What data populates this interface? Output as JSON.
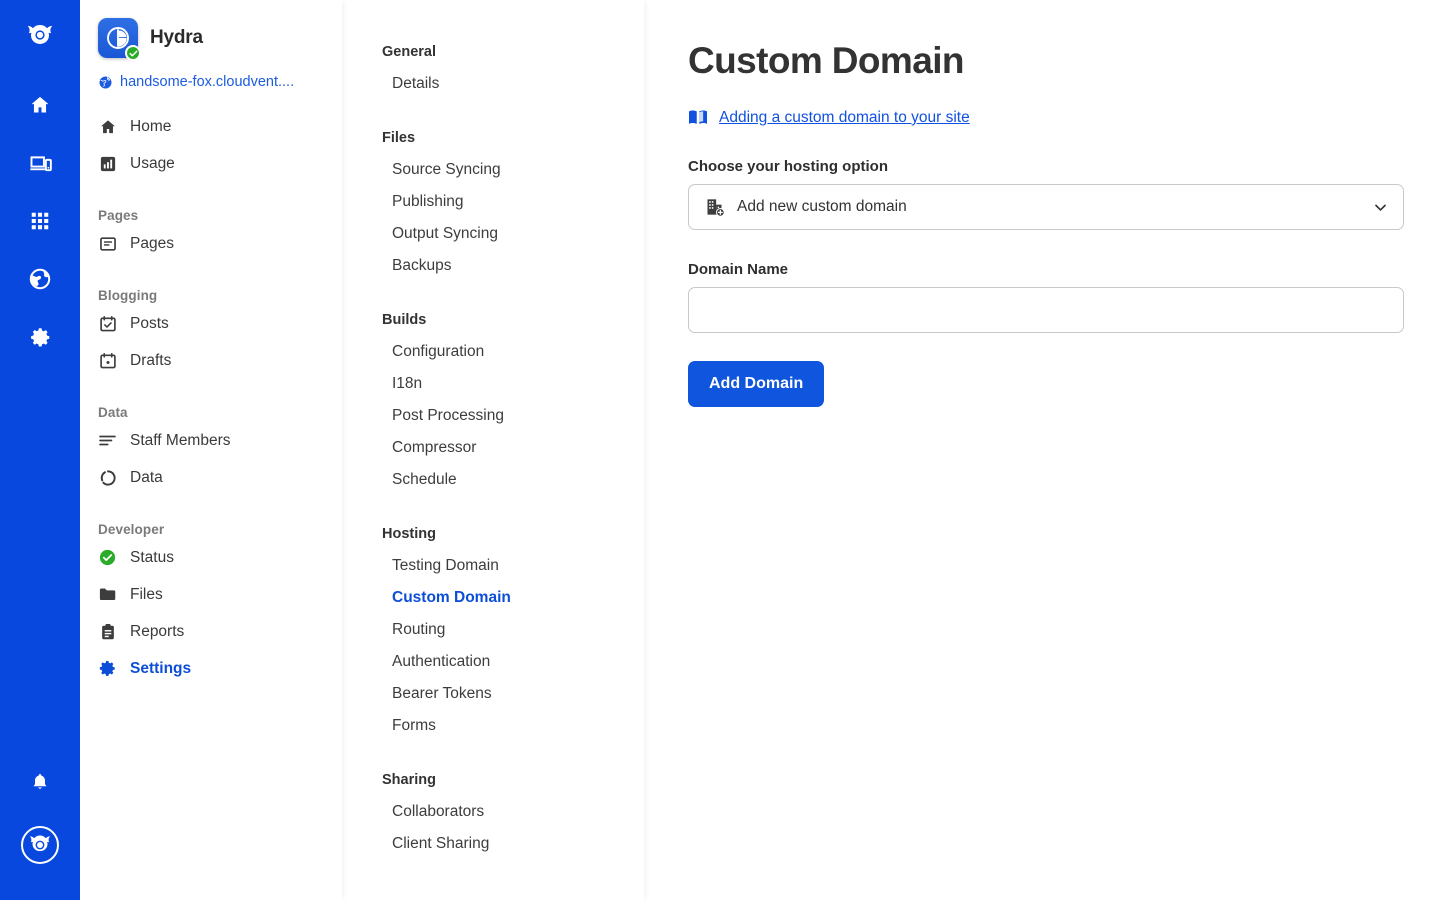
{
  "rail": {
    "logo_icon": "cloudvent-logo-icon",
    "items": [
      {
        "icon": "home-icon",
        "name": "home"
      },
      {
        "icon": "devices-icon",
        "name": "devices"
      },
      {
        "icon": "apps-grid-icon",
        "name": "apps"
      },
      {
        "icon": "globe-icon",
        "name": "globe"
      },
      {
        "icon": "gear-icon",
        "name": "settings"
      }
    ],
    "bottom": [
      {
        "icon": "bell-icon",
        "name": "notifications"
      },
      {
        "icon": "account-avatar-icon",
        "name": "account"
      }
    ]
  },
  "sidebar": {
    "site_name": "Hydra",
    "site_status_badge": "verified-check",
    "site_url": "handsome-fox.cloudvent....",
    "groups": [
      {
        "label": "",
        "items": [
          {
            "label": "Home",
            "icon": "home-icon",
            "active": false
          },
          {
            "label": "Usage",
            "icon": "usage-chart-icon",
            "active": false
          }
        ]
      },
      {
        "label": "Pages",
        "items": [
          {
            "label": "Pages",
            "icon": "page-icon",
            "active": false
          }
        ]
      },
      {
        "label": "Blogging",
        "items": [
          {
            "label": "Posts",
            "icon": "calendar-check-icon",
            "active": false
          },
          {
            "label": "Drafts",
            "icon": "calendar-dot-icon",
            "active": false
          }
        ]
      },
      {
        "label": "Data",
        "items": [
          {
            "label": "Staff Members",
            "icon": "list-lines-icon",
            "active": false
          },
          {
            "label": "Data",
            "icon": "circle-dashed-icon",
            "active": false
          }
        ]
      },
      {
        "label": "Developer",
        "items": [
          {
            "label": "Status",
            "icon": "status-check-icon",
            "active": false
          },
          {
            "label": "Files",
            "icon": "folder-icon",
            "active": false
          },
          {
            "label": "Reports",
            "icon": "clipboard-icon",
            "active": false
          },
          {
            "label": "Settings",
            "icon": "gear-icon",
            "active": true
          }
        ]
      }
    ]
  },
  "settings_nav": {
    "groups": [
      {
        "label": "General",
        "items": [
          {
            "label": "Details",
            "active": false
          }
        ]
      },
      {
        "label": "Files",
        "items": [
          {
            "label": "Source Syncing",
            "active": false
          },
          {
            "label": "Publishing",
            "active": false
          },
          {
            "label": "Output Syncing",
            "active": false
          },
          {
            "label": "Backups",
            "active": false
          }
        ]
      },
      {
        "label": "Builds",
        "items": [
          {
            "label": "Configuration",
            "active": false
          },
          {
            "label": "I18n",
            "active": false
          },
          {
            "label": "Post Processing",
            "active": false
          },
          {
            "label": "Compressor",
            "active": false
          },
          {
            "label": "Schedule",
            "active": false
          }
        ]
      },
      {
        "label": "Hosting",
        "items": [
          {
            "label": "Testing Domain",
            "active": false
          },
          {
            "label": "Custom Domain",
            "active": true
          },
          {
            "label": "Routing",
            "active": false
          },
          {
            "label": "Authentication",
            "active": false
          },
          {
            "label": "Bearer Tokens",
            "active": false
          },
          {
            "label": "Forms",
            "active": false
          }
        ]
      },
      {
        "label": "Sharing",
        "items": [
          {
            "label": "Collaborators",
            "active": false
          },
          {
            "label": "Client Sharing",
            "active": false
          }
        ]
      }
    ]
  },
  "main": {
    "title": "Custom Domain",
    "doc_link": "Adding a custom domain to your site",
    "doc_link_icon": "book-icon",
    "hosting_option_label": "Choose your hosting option",
    "hosting_option_value": "Add new custom domain",
    "hosting_option_icon": "building-add-icon",
    "domain_name_label": "Domain Name",
    "domain_name_value": "",
    "domain_name_placeholder": "",
    "submit_label": "Add Domain"
  },
  "colors": {
    "rail_blue": "#0848de",
    "accent_blue": "#1055dd",
    "link_blue": "#1151e0",
    "status_green": "#2aac2a"
  }
}
